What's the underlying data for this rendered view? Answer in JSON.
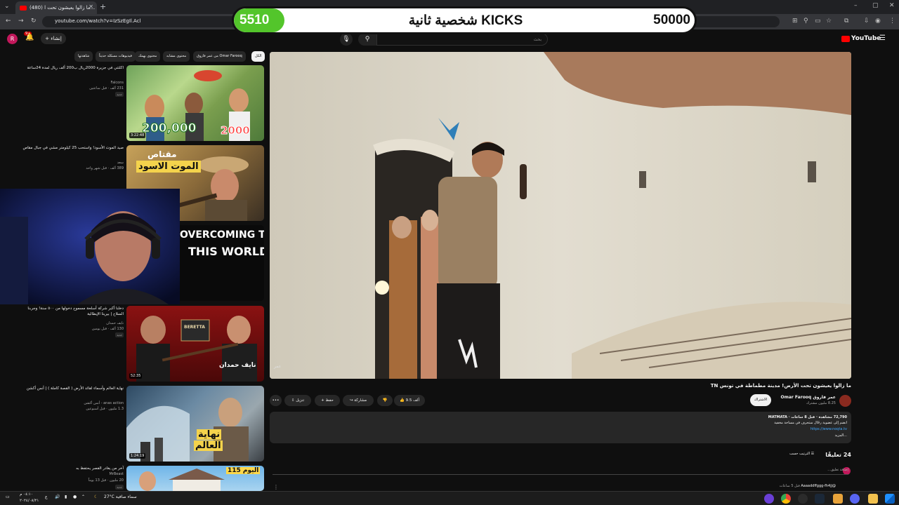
{
  "browser": {
    "tab_title": "(480) ما زالوا يعيشون تحت ا...",
    "url": "youtube.com/watch?v=IzSzEgIl.Acl",
    "close_symbol": "✕",
    "new_tab_symbol": "+"
  },
  "banner": {
    "current": "5510",
    "title": "KICKS شخصية ثانية",
    "goal": "50000",
    "progress_fraction": 0.11,
    "fill_color": "#53c52b"
  },
  "header": {
    "create_label": "إنشاء",
    "notif_count": "9+",
    "search_placeholder": "بحث",
    "logo": "YouTube",
    "avatar_letter": "R"
  },
  "chips": [
    {
      "label": "الكل",
      "active": true
    },
    {
      "label": "من عمر فاروق Omar Farooq",
      "active": false
    },
    {
      "label": "محتوى مشابه",
      "active": false
    },
    {
      "label": "محتوى يهمك",
      "active": false
    },
    {
      "label": "فيديوهات مسكلة حديثاً",
      "active": false
    },
    {
      "label": "شاهدتها",
      "active": false
    }
  ],
  "related": [
    {
      "title": "اكلتتي في جزيرة 2000ريال ب200 ألف ريال لمدة 24ساعة",
      "channel": "Falcons",
      "meta": "231 ألف · قبل ساعتين",
      "badge": "جديد",
      "duration": "3:22:48",
      "thumb_text_1": "200,000",
      "thumb_text_2": "2000"
    },
    {
      "title": "صيد الموت الأسود! واستحب 25 كيلومتر مشي في جبال مقاص",
      "channel": "سعد",
      "meta": "389 ألف · قبل شهر واحد",
      "badge": "",
      "duration": "",
      "thumb_text_1": "مقتاص",
      "thumb_text_2": "الموت الاسود"
    },
    {
      "title": "OVERCOMING THE THIS WORLD",
      "channel": "",
      "meta": "",
      "badge": "",
      "duration": "",
      "thumb_text_1": "OVERCOMING THE",
      "thumb_text_2": "THIS WORLD"
    },
    {
      "title": "دخلنا أكبر شركة أسلحة مسموح دخولها من ٥٠٠ سنة! وجربنا السلاح | بيريتا الإيطالية",
      "channel": "نايف حمدان",
      "meta": "130 ألف · قبل يومين",
      "badge": "جديد",
      "duration": "52:35",
      "thumb_text_1": "BERETTA",
      "thumb_text_2": "نايف حمدان"
    },
    {
      "title": "نهاية العالم وأسماء لقائد الأرض ( القصة كاملة ) | أنس أكشن",
      "channel": "anas action - أنس أكشن",
      "meta": "1.3 مليون · قبل أسبوعين",
      "badge": "",
      "duration": "1:24:19",
      "thumb_text_1": "نهاية",
      "thumb_text_2": "العالم"
    },
    {
      "title": "آخر من يغادر القصر يحتفظ به",
      "channel": "MrBeast",
      "meta": "20 مليون · قبل 13 يوماً",
      "badge": "جديد",
      "duration": "",
      "thumb_text_1": "اليوم 115",
      "thumb_text_2": ""
    }
  ],
  "video": {
    "title": "ما زالوا يعيشون تحت الأرض! مدينة مطماطة في تونس TN",
    "channel": "عمر فاروق Omar Farooq",
    "subs": "8.25 مليون مشترك",
    "subscribe": "الاشتراك",
    "likes": "9.5 ألف",
    "share": "مشاركة",
    "save": "حفظ",
    "download": "تنزيل",
    "more": "•••",
    "watermark": "عمر"
  },
  "description": {
    "stats": "72,790 مشاهدة · قبل 8 ساعات · MATMATA",
    "line1": "انضم إلى عضوية رحّال ستحرف في مساحة مخفية",
    "link": "https://www.noqta.tv",
    "more": "...المزيد"
  },
  "comments": {
    "heading": "24 تعليقًا",
    "sort": "الترتيب حسب",
    "add_placeholder": "إضافة تعليق...",
    "first_author": "@Aaaaddffggg-fh4jj",
    "first_time": "قبل 5 ساعات"
  },
  "taskbar": {
    "time": "٠٤:١٠ م",
    "date": "٢٠٢٤/٠٨/٢١",
    "weather": "27°C  سماء صافية",
    "lang": "ع"
  }
}
